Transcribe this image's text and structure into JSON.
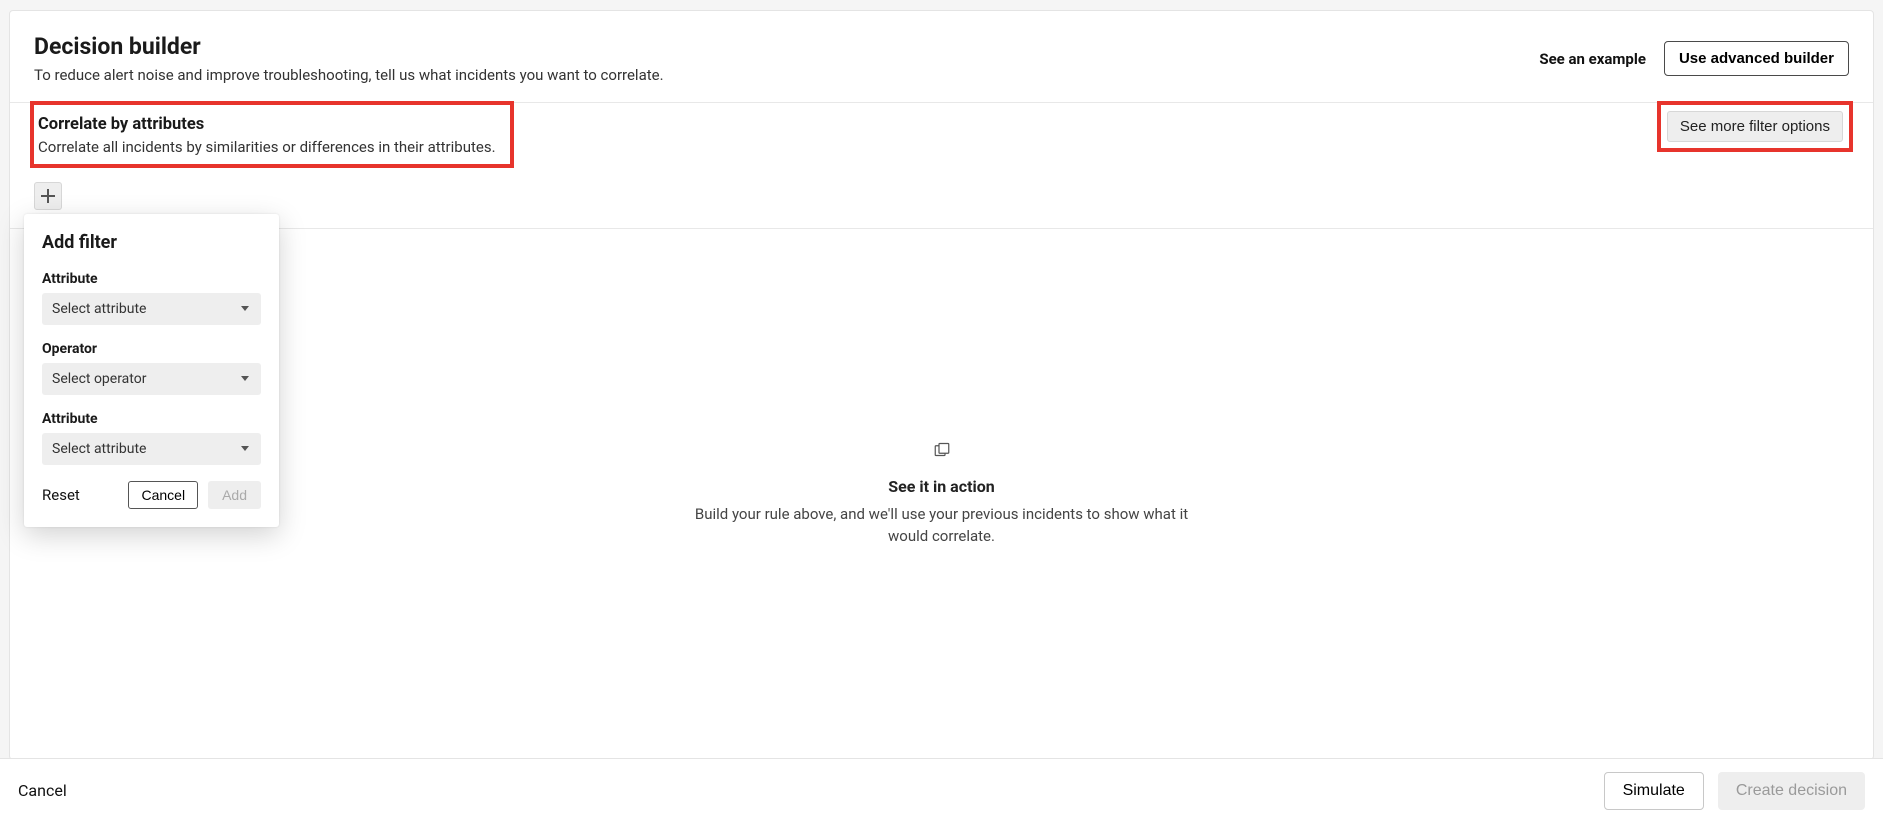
{
  "header": {
    "title": "Decision builder",
    "description": "To reduce alert noise and improve troubleshooting, tell us what incidents you want to correlate.",
    "see_example": "See an example",
    "advanced_builder": "Use advanced builder"
  },
  "correlate": {
    "title": "Correlate by attributes",
    "description": "Correlate all incidents by similarities or differences in their attributes.",
    "see_more": "See more filter options"
  },
  "popover": {
    "title": "Add filter",
    "attribute_label": "Attribute",
    "attribute_placeholder": "Select attribute",
    "operator_label": "Operator",
    "operator_placeholder": "Select operator",
    "attribute2_label": "Attribute",
    "attribute2_placeholder": "Select attribute",
    "reset": "Reset",
    "cancel": "Cancel",
    "add": "Add"
  },
  "preview": {
    "title": "See it in action",
    "description": "Build your rule above, and we'll use your previous incidents to show what it would correlate."
  },
  "footer": {
    "cancel": "Cancel",
    "simulate": "Simulate",
    "create": "Create decision"
  }
}
